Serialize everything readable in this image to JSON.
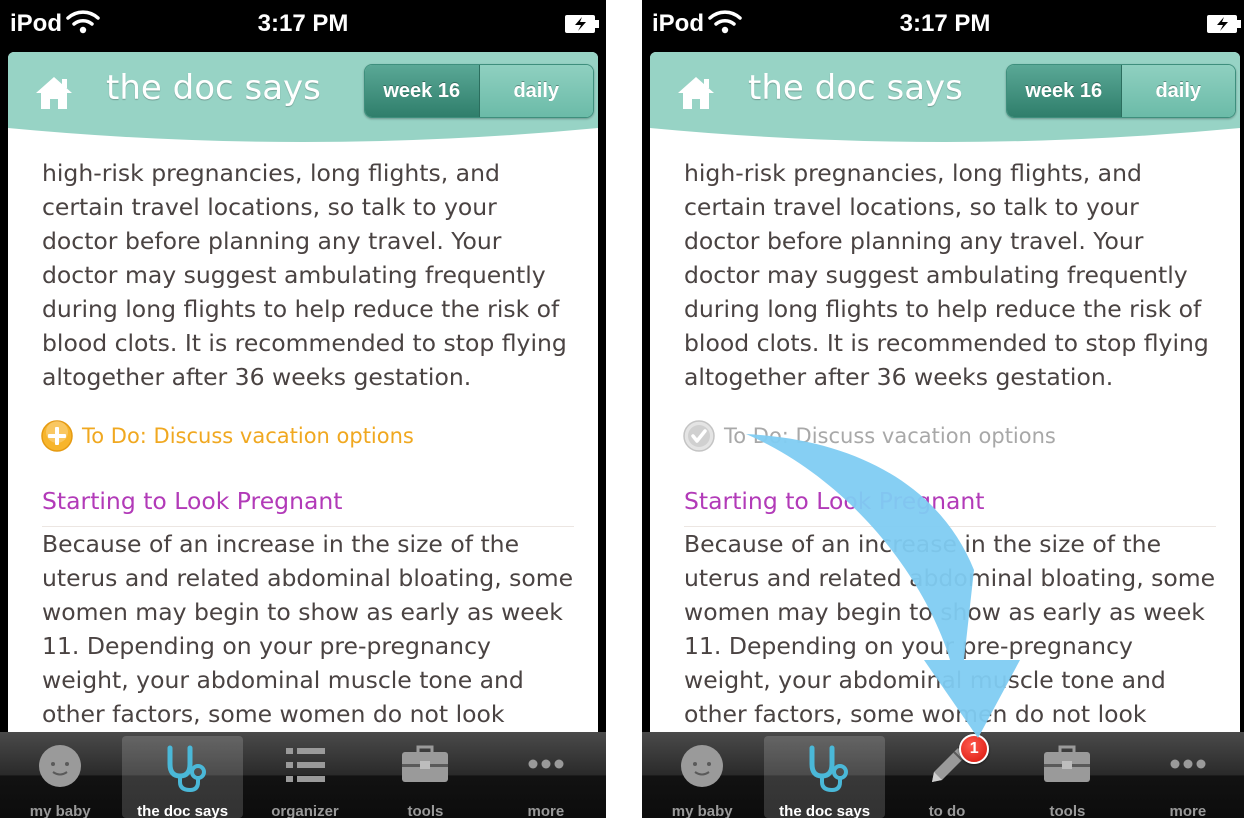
{
  "screens": [
    {
      "status": {
        "carrier": "iPod",
        "time": "3:17 PM"
      },
      "header": {
        "title": "the doc says",
        "segment_week": "week 16",
        "segment_daily": "daily"
      },
      "content": {
        "paragraph1": "high-risk pregnancies, long flights, and certain travel locations, so talk to your doctor before planning any travel. Your doctor may suggest ambulating frequently during long flights to help reduce the risk of blood clots. It is recommended to stop flying altogether after 36 weeks gestation.",
        "todo": "To Do: Discuss vacation options",
        "todo_state": "add",
        "heading": "Starting to Look Pregnant",
        "paragraph2": "Because of an increase in the size of the uterus and related abdominal bloating, some women may begin to show as early as week 11. Depending on your pre-pregnancy weight, your abdominal muscle tone and other factors, some women do not look"
      },
      "tabs": [
        {
          "label": "my baby",
          "icon": "baby-face-icon",
          "selected": false
        },
        {
          "label": "the doc says",
          "icon": "stethoscope-icon",
          "selected": true
        },
        {
          "label": "organizer",
          "icon": "list-icon",
          "selected": false
        },
        {
          "label": "tools",
          "icon": "toolbox-icon",
          "selected": false
        },
        {
          "label": "more",
          "icon": "more-dots-icon",
          "selected": false
        }
      ]
    },
    {
      "status": {
        "carrier": "iPod",
        "time": "3:17 PM"
      },
      "header": {
        "title": "the doc says",
        "segment_week": "week 16",
        "segment_daily": "daily"
      },
      "content": {
        "paragraph1": "high-risk pregnancies, long flights, and certain travel locations, so talk to your doctor before planning any travel. Your doctor may suggest ambulating frequently during long flights to help reduce the risk of blood clots. It is recommended to stop flying altogether after 36 weeks gestation.",
        "todo": "To Do: Discuss vacation options",
        "todo_state": "done",
        "heading": "Starting to Look Pregnant",
        "paragraph2": "Because of an increase in the size of the uterus and related abdominal bloating, some women may begin to show as early as week 11. Depending on your pre-pregnancy weight, your abdominal muscle tone and other factors, some women do not look"
      },
      "tabs": [
        {
          "label": "my baby",
          "icon": "baby-face-icon",
          "selected": false
        },
        {
          "label": "the doc says",
          "icon": "stethoscope-icon",
          "selected": true
        },
        {
          "label": "to do",
          "icon": "pencil-icon",
          "selected": false,
          "badge": "1"
        },
        {
          "label": "tools",
          "icon": "toolbox-icon",
          "selected": false
        },
        {
          "label": "more",
          "icon": "more-dots-icon",
          "selected": false
        }
      ]
    }
  ],
  "colors": {
    "header_teal": "#97d3c5",
    "todo_orange": "#f0a820",
    "heading_purple": "#b23ab8",
    "arrow_blue": "#7fccf2"
  }
}
